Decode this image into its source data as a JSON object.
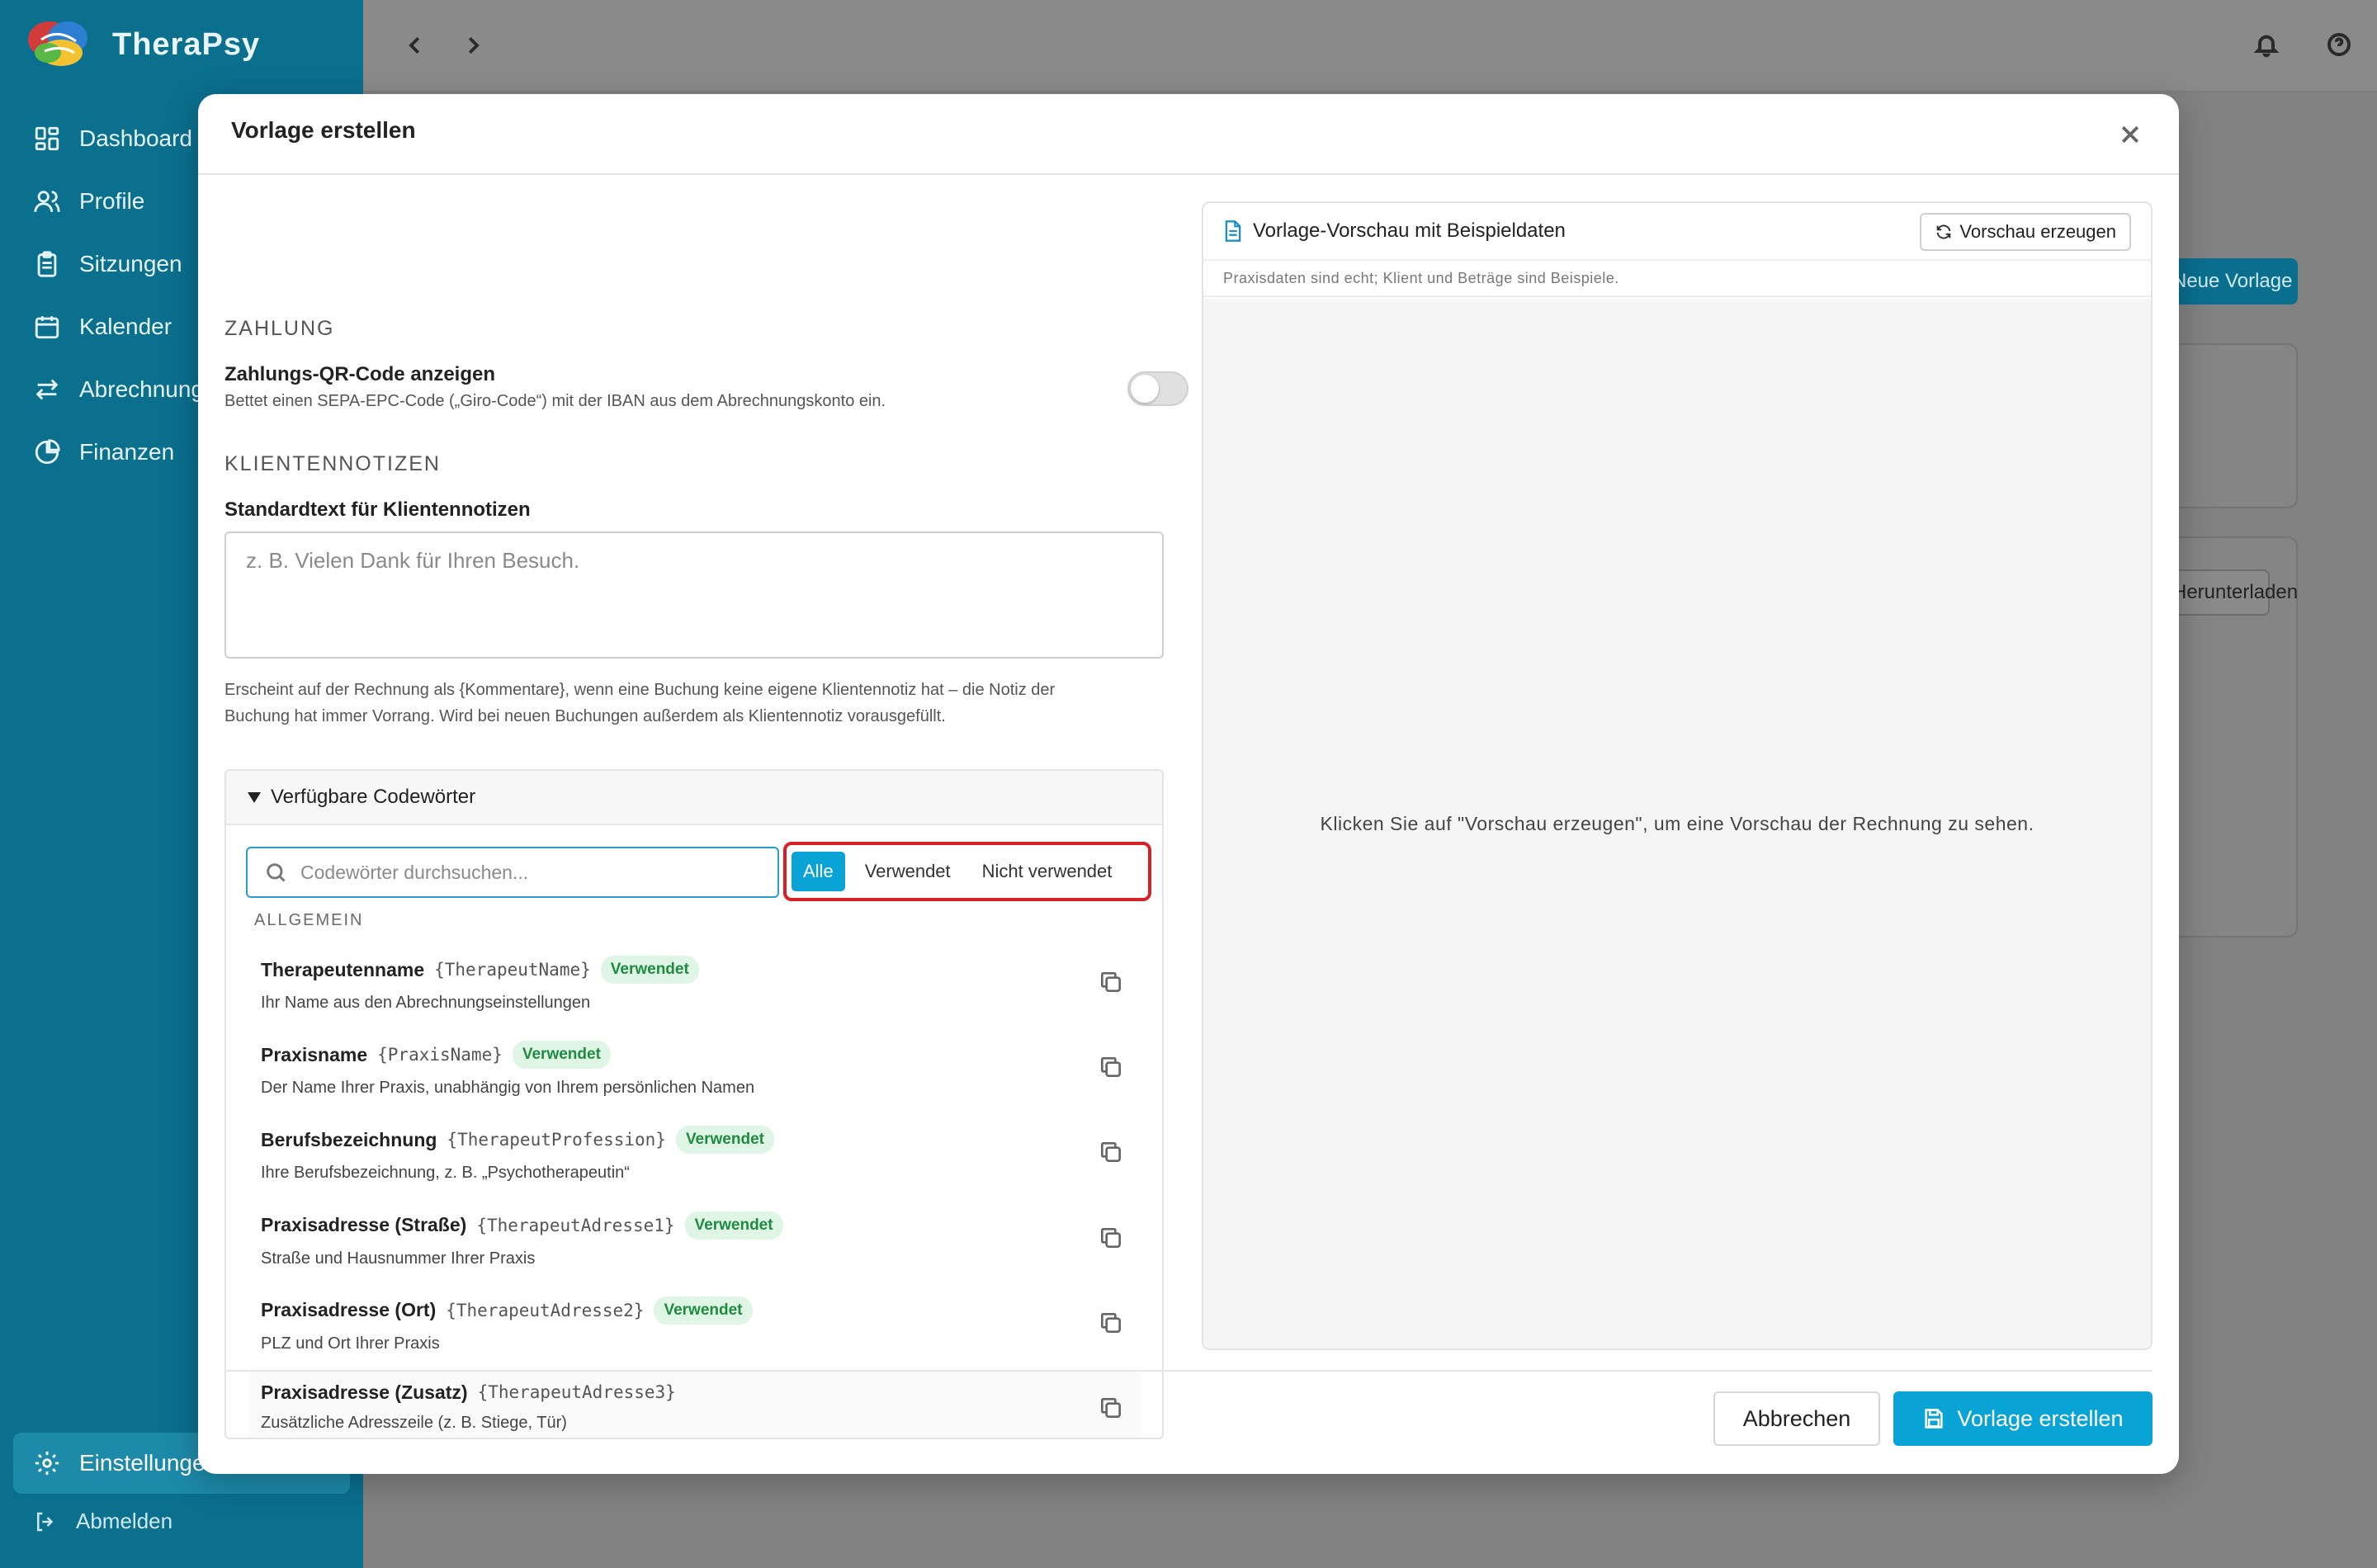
{
  "app": {
    "name": "TheraPsy",
    "nav": [
      {
        "label": "Dashboard",
        "icon": "dashboard-icon"
      },
      {
        "label": "Profile",
        "icon": "users-icon"
      },
      {
        "label": "Sitzungen",
        "icon": "clipboard-icon"
      },
      {
        "label": "Kalender",
        "icon": "calendar-icon"
      },
      {
        "label": "Abrechnung",
        "icon": "arrows-exchange-icon"
      },
      {
        "label": "Finanzen",
        "icon": "pie-chart-icon"
      }
    ],
    "settings_label": "Einstellungen",
    "logout_label": "Abmelden",
    "background_new_button": "Neue Vorlage",
    "background_download_button": "Herunterladen"
  },
  "modal": {
    "title": "Vorlage erstellen",
    "payment": {
      "section": "ZAHLUNG",
      "qr_label": "Zahlungs-QR-Code anzeigen",
      "qr_help": "Bettet einen SEPA-EPC-Code („Giro-Code“) mit der IBAN aus dem Abrechnungskonto ein.",
      "qr_enabled": false
    },
    "notes": {
      "section": "KLIENTENNOTIZEN",
      "label": "Standardtext für Klientennotizen",
      "placeholder": "z. B. Vielen Dank für Ihren Besuch.",
      "value": "",
      "help_1": "Erscheint auf der Rechnung als {Kommentare}, wenn eine Buchung keine eigene Klientennotiz hat – die Notiz der",
      "help_2": "Buchung hat immer Vorrang. Wird bei neuen Buchungen außerdem als Klientennotiz vorausgefüllt."
    },
    "codewords": {
      "summary": "Verfügbare Codewörter",
      "search_placeholder": "Codewörter durchsuchen...",
      "filters": [
        "Alle",
        "Verwendet",
        "Nicht verwendet"
      ],
      "active_filter": "Alle",
      "group": "ALLGEMEIN",
      "items": [
        {
          "name": "Therapeutenname",
          "code": "{TherapeutName}",
          "badge": "Verwendet",
          "desc": "Ihr Name aus den Abrechnungseinstellungen"
        },
        {
          "name": "Praxisname",
          "code": "{PraxisName}",
          "badge": "Verwendet",
          "desc": "Der Name Ihrer Praxis, unabhängig von Ihrem persönlichen Namen"
        },
        {
          "name": "Berufsbezeichnung",
          "code": "{TherapeutProfession}",
          "badge": "Verwendet",
          "desc": "Ihre Berufsbezeichnung, z. B. „Psychotherapeutin“"
        },
        {
          "name": "Praxisadresse (Straße)",
          "code": "{TherapeutAdresse1}",
          "badge": "Verwendet",
          "desc": "Straße und Hausnummer Ihrer Praxis"
        },
        {
          "name": "Praxisadresse (Ort)",
          "code": "{TherapeutAdresse2}",
          "badge": "Verwendet",
          "desc": "PLZ und Ort Ihrer Praxis"
        },
        {
          "name": "Praxisadresse (Zusatz)",
          "code": "{TherapeutAdresse3}",
          "badge": "",
          "desc": "Zusätzliche Adresszeile (z. B. Stiege, Tür)"
        }
      ]
    },
    "preview": {
      "title": "Vorlage-Vorschau mit Beispieldaten",
      "button": "Vorschau erzeugen",
      "subtitle": "Praxisdaten sind echt; Klient und Beträge sind Beispiele.",
      "empty": "Klicken Sie auf \"Vorschau erzeugen\", um eine Vorschau der Rechnung zu sehen."
    },
    "footer": {
      "cancel": "Abbrechen",
      "submit": "Vorlage erstellen"
    }
  },
  "colors": {
    "sidebar": "#0b6f8e",
    "accent": "#0aa3d6",
    "highlight_border": "#d91f26",
    "badge_bg": "#dff5e6",
    "badge_text": "#1e8b3f"
  }
}
